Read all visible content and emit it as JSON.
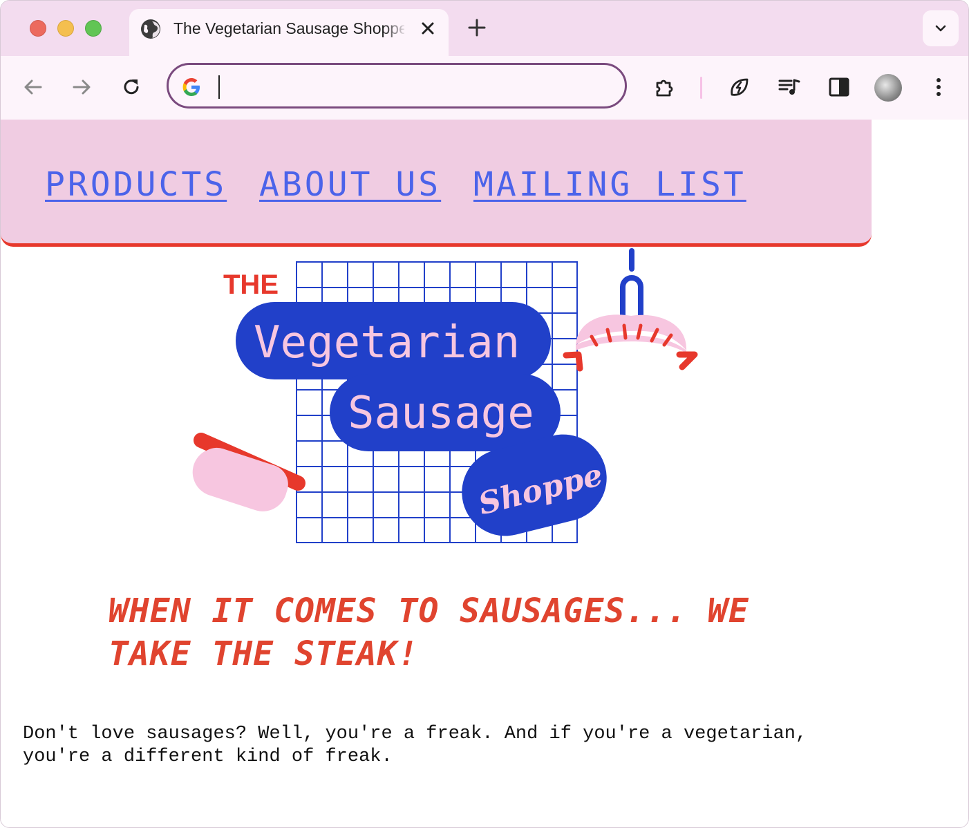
{
  "browser": {
    "tab": {
      "title": "The Vegetarian Sausage Shoppe"
    },
    "omnibox": {
      "value": "",
      "placeholder": ""
    },
    "icons": {
      "back": "arrow-left-icon",
      "forward": "arrow-right-icon",
      "reload": "reload-icon",
      "extensions": "puzzle-icon",
      "leaf_extension": "leaf-bolt-icon",
      "media": "media-queue-icon",
      "side_panel": "side-panel-icon",
      "profile": "profile-avatar",
      "menu": "kebab-menu-icon"
    }
  },
  "site": {
    "nav": [
      {
        "label": "PRODUCTS"
      },
      {
        "label": "ABOUT US"
      },
      {
        "label": "MAILING LIST"
      }
    ],
    "logo": {
      "the": "THE",
      "line1": "Vegetarian",
      "line2": "Sausage",
      "line3": "Shoppe"
    },
    "tagline": "WHEN IT COMES TO SAUSAGES... WE TAKE THE STEAK!",
    "body": "Don't love sausages? Well, you're a freak. And if you're a vegetarian, you're a different kind of freak."
  },
  "colors": {
    "nav_bg": "#f0cce2",
    "nav_link": "#4b63ea",
    "accent_red": "#e7382c",
    "logo_blue": "#2140c9",
    "logo_pink": "#f7c6e0"
  }
}
